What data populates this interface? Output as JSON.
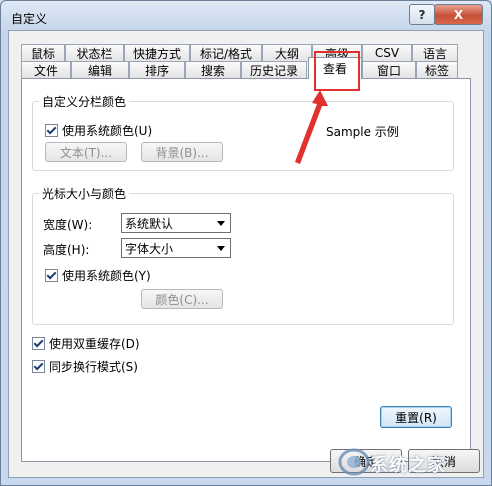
{
  "window": {
    "title": "自定义",
    "help_label": "?",
    "close_label": "X"
  },
  "tabs_row1": [
    "鼠标",
    "状态栏",
    "快捷方式",
    "标记/格式",
    "大纲",
    "高级",
    "CSV",
    "语言"
  ],
  "tabs_row2": [
    "文件",
    "编辑",
    "排序",
    "搜索",
    "历史记录",
    "查看",
    "窗口",
    "标签"
  ],
  "active_tab": "查看",
  "group1": {
    "title": "自定义分栏颜色",
    "use_system_colors": "使用系统颜色(U)",
    "text_button": "文本(T)...",
    "bg_button": "背景(B)..."
  },
  "group2": {
    "title": "光标大小与颜色",
    "width_label": "宽度(W):",
    "width_value": "系统默认",
    "height_label": "高度(H):",
    "height_value": "字体大小",
    "use_system_colors": "使用系统颜色(Y)",
    "color_button": "颜色(C)..."
  },
  "options": {
    "double_buffer": "使用双重缓存(D)",
    "sync_scroll": "同步换行模式(S)"
  },
  "reset_button": "重置(R)",
  "footer": {
    "ok_label": "确定",
    "cancel_label": "取消"
  },
  "annotation": {
    "text": "Sample 示例"
  },
  "watermark": {
    "text": "系统之家"
  },
  "colors": {
    "annotation": "#e0312f",
    "accent": "#3c7fb1"
  }
}
